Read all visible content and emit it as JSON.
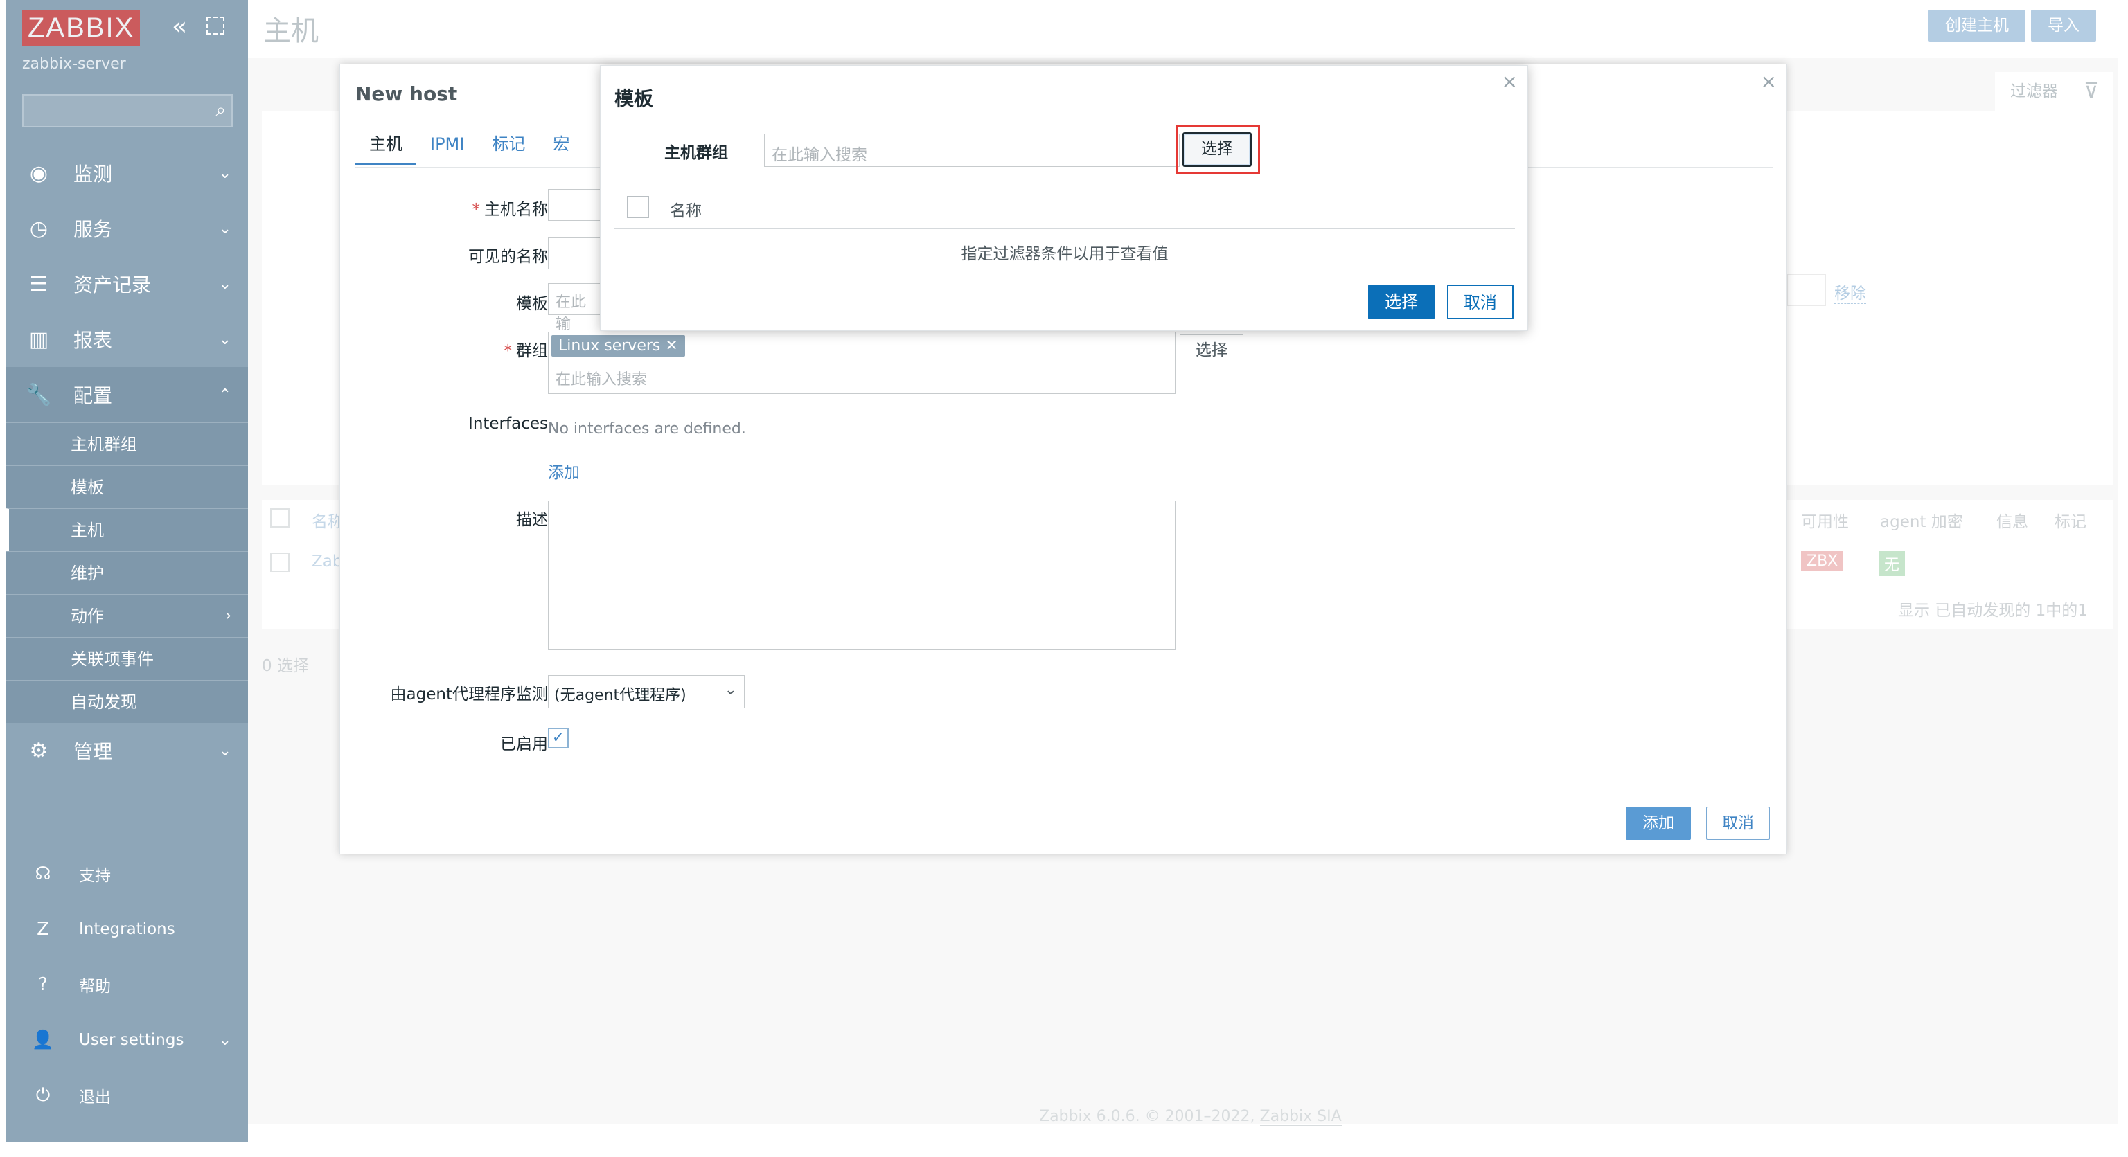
{
  "sidebar": {
    "logo": "ZABBIX",
    "server_name": "zabbix-server",
    "collapse_glyph": "«",
    "nav": [
      {
        "label": "监测",
        "icon": "eye-icon"
      },
      {
        "label": "服务",
        "icon": "clock-icon"
      },
      {
        "label": "资产记录",
        "icon": "list-icon"
      },
      {
        "label": "报表",
        "icon": "bar-chart-icon"
      },
      {
        "label": "配置",
        "icon": "wrench-icon"
      }
    ],
    "config_sub": [
      "主机群组",
      "模板",
      "主机",
      "维护",
      "动作",
      "关联项事件",
      "自动发现"
    ],
    "admin": {
      "label": "管理",
      "icon": "gear-icon"
    },
    "bottom": [
      {
        "label": "支持",
        "icon": "headset-icon"
      },
      {
        "label": "Integrations",
        "icon": "z-icon"
      },
      {
        "label": "帮助",
        "icon": "question-icon"
      },
      {
        "label": "User settings",
        "icon": "user-icon"
      },
      {
        "label": "退出",
        "icon": "power-icon"
      }
    ]
  },
  "page": {
    "title": "主机",
    "create_host": "创建主机",
    "import": "导入",
    "filter_label": "过滤器",
    "remove_link": "移除",
    "table_headers": [
      "名称",
      "可用性",
      "agent 加密",
      "信息",
      "标记"
    ],
    "row_name_fragment": "Zab",
    "badge_zbx": "ZBX",
    "badge_none": "无",
    "display_count": "显示 已自动发现的 1中的1",
    "selected_count": "0 选择",
    "footer_text": "Zabbix 6.0.6. © 2001–2022, ",
    "footer_link": "Zabbix SIA"
  },
  "new_host_dialog": {
    "title": "New host",
    "tabs": [
      "主机",
      "IPMI",
      "标记",
      "宏"
    ],
    "labels": {
      "host_name": "主机名称",
      "visible_name": "可见的名称",
      "templates": "模板",
      "groups": "群组",
      "interfaces": "Interfaces",
      "description": "描述",
      "proxy": "由agent代理程序监测",
      "enabled": "已启用"
    },
    "templates_placeholder": "在此输",
    "group_chip": "Linux servers",
    "groups_placeholder": "在此输入搜索",
    "group_select": "选择",
    "no_interfaces": "No interfaces are defined.",
    "add_link": "添加",
    "proxy_value": "(无agent代理程序)",
    "add_button": "添加",
    "cancel_button": "取消"
  },
  "template_dialog": {
    "title": "模板",
    "host_group_label": "主机群组",
    "search_placeholder": "在此输入搜索",
    "select_button": "选择",
    "column_name": "名称",
    "empty_text": "指定过滤器条件以用于查看值",
    "confirm_button": "选择",
    "cancel_button": "取消"
  }
}
